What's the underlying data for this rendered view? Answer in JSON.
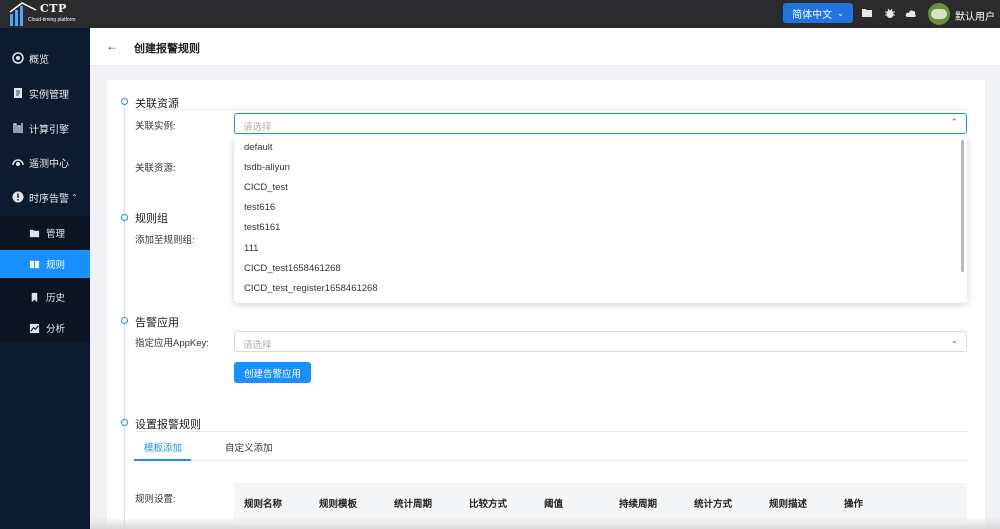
{
  "topbar": {
    "logo_text": "CTP",
    "logo_sub": "Cloud-timing platform",
    "language": "简体中文",
    "username": "默认用户"
  },
  "sidebar": {
    "items": [
      {
        "label": "概览",
        "icon": "dashboard-icon"
      },
      {
        "label": "实例管理",
        "icon": "document-icon"
      },
      {
        "label": "计算引擎",
        "icon": "engine-icon"
      },
      {
        "label": "遥测中心",
        "icon": "telemetry-icon"
      },
      {
        "label": "时序告警",
        "icon": "alert-icon",
        "expanded": true
      }
    ],
    "sub_items": [
      {
        "label": "管理",
        "icon": "folder-icon"
      },
      {
        "label": "规则",
        "icon": "rule-icon",
        "active": true
      },
      {
        "label": "历史",
        "icon": "bookmark-icon"
      },
      {
        "label": "分析",
        "icon": "chart-icon"
      }
    ],
    "accent": "#1890ff"
  },
  "header": {
    "title": "创建报警规则"
  },
  "form": {
    "section_resource": "关联资源",
    "label_instance": "关联实例:",
    "instance_placeholder": "请选择",
    "label_resource": "关联资源:",
    "section_rule_group": "规则组",
    "label_rule_group": "添加至规则组:",
    "section_alert_app": "告警应用",
    "label_appkey": "指定应用AppKey:",
    "appkey_placeholder": "请选择",
    "create_app_button": "创建告警应用",
    "section_rules": "设置报警规则",
    "tabs": [
      "模板添加",
      "自定义添加"
    ],
    "label_rule_settings": "规则设置:",
    "table_headers": [
      "规则名称",
      "规则模板",
      "统计周期",
      "比较方式",
      "阈值",
      "持续周期",
      "统计方式",
      "规则描述",
      "操作"
    ]
  },
  "dropdown": {
    "options": [
      "default",
      "tsdb-aliyun",
      "CICD_test",
      "test616",
      "test6161",
      "111",
      "CICD_test1658461268",
      "CICD_test_register1658461268"
    ]
  }
}
